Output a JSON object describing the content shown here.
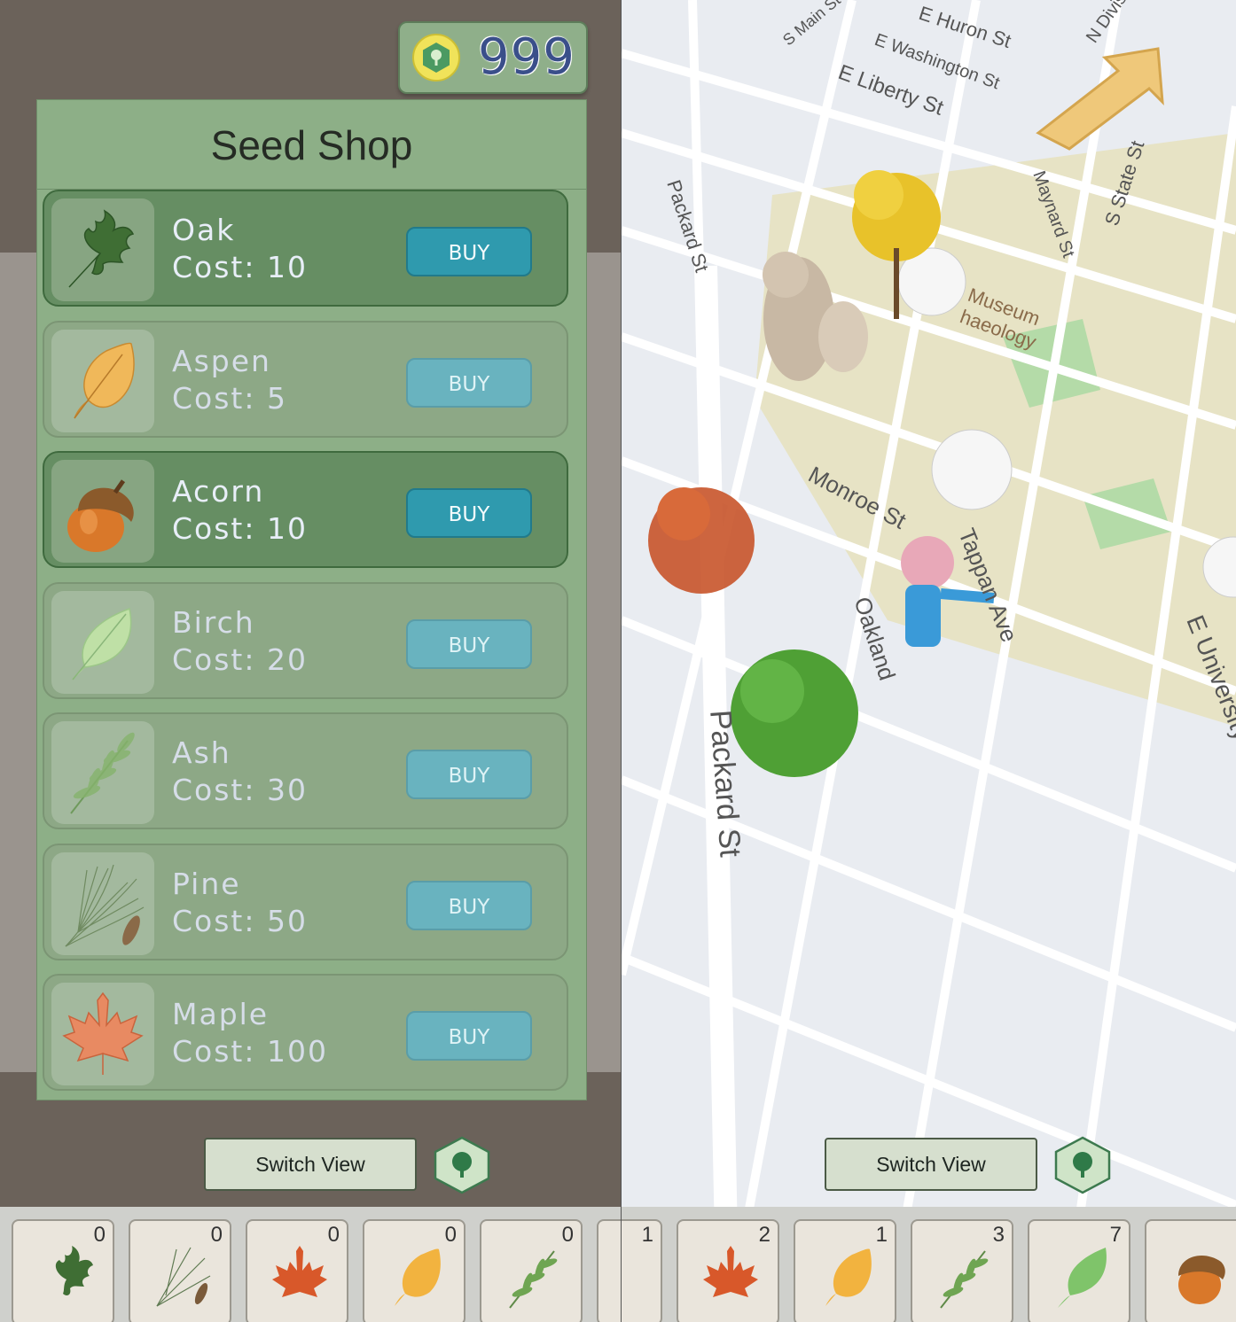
{
  "currency": {
    "value": "999"
  },
  "shop": {
    "title": "Seed Shop",
    "items": [
      {
        "name": "Oak",
        "cost": "Cost: 10",
        "buy": "BUY",
        "icon": "oak-leaf-icon"
      },
      {
        "name": "Aspen",
        "cost": "Cost: 5",
        "buy": "BUY",
        "icon": "aspen-leaf-icon"
      },
      {
        "name": "Acorn",
        "cost": "Cost: 10",
        "buy": "BUY",
        "icon": "acorn-icon"
      },
      {
        "name": "Birch",
        "cost": "Cost: 20",
        "buy": "BUY",
        "icon": "birch-leaf-icon"
      },
      {
        "name": "Ash",
        "cost": "Cost: 30",
        "buy": "BUY",
        "icon": "ash-leaf-icon"
      },
      {
        "name": "Pine",
        "cost": "Cost: 50",
        "buy": "BUY",
        "icon": "pine-needles-icon"
      },
      {
        "name": "Maple",
        "cost": "Cost: 100",
        "buy": "BUY",
        "icon": "maple-leaf-icon"
      }
    ]
  },
  "controls": {
    "switch_view": "Switch View"
  },
  "inventory_left": [
    {
      "icon": "oak-leaf-icon",
      "count": "0"
    },
    {
      "icon": "pine-needles-icon",
      "count": "0"
    },
    {
      "icon": "maple-leaf-icon",
      "count": "0"
    },
    {
      "icon": "aspen-leaf-icon",
      "count": "0"
    },
    {
      "icon": "ash-leaf-icon",
      "count": "0"
    }
  ],
  "inventory_right": [
    {
      "icon": "pine-needles-icon",
      "count": "1"
    },
    {
      "icon": "maple-leaf-icon",
      "count": "2"
    },
    {
      "icon": "aspen-leaf-icon",
      "count": "1"
    },
    {
      "icon": "ash-leaf-icon",
      "count": "3"
    },
    {
      "icon": "birch-leaf-icon",
      "count": "7"
    },
    {
      "icon": "acorn-icon",
      "count": ""
    }
  ],
  "map": {
    "streets": [
      "E Huron St",
      "E Washington St",
      "E Liberty St",
      "S Main St",
      "N Division St",
      "Packard St",
      "Maynard St",
      "S State St",
      "Monroe St",
      "Tappan Ave",
      "Oakland",
      "E University Ave",
      "Packard St"
    ],
    "poi": "Museum\nhaeology"
  },
  "colors": {
    "panel": "#8daf87",
    "active_item": "#668e63",
    "buy": "#2f9aae",
    "coin_text": "#3a4f8a"
  }
}
